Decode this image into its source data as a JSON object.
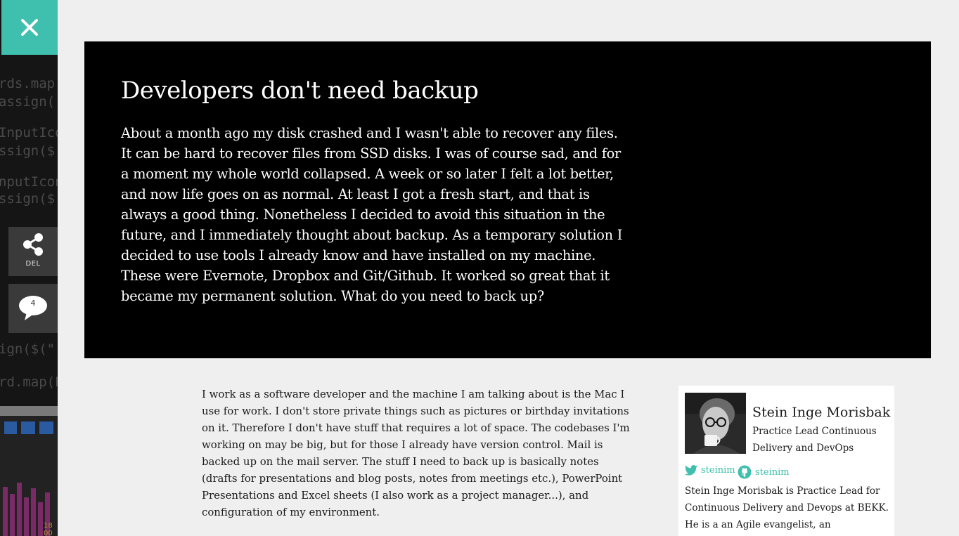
{
  "sidebar": {
    "close_icon": "close-icon",
    "share": {
      "icon": "share-icon",
      "label": "DEL"
    },
    "comments": {
      "icon": "comment-bubble-icon",
      "count": "4"
    },
    "code_lines": [
      "rds.map(",
      "assign(",
      "InputIco",
      "ssign($",
      "nputIcon",
      "ssign($(",
      "ign($(\"[",
      "rd.map(E"
    ],
    "screenshot_label": "18 00"
  },
  "article": {
    "title": "Developers don't need backup",
    "intro": "About a month ago my disk crashed and I wasn't able to recover any files. It can be hard to recover files from SSD disks. I was of course sad, and for a moment my whole world collapsed. A week or so later I felt a lot better, and now life goes on as normal. At least I got a fresh start, and that is always a good thing. Nonetheless I decided to avoid this situation in the future, and I immediately thought about backup. As a temporary solution I decided to use tools I already know and have installed on my machine. These were Evernote, Dropbox and Git/Github. It worked so great that it became my permanent solution. What do you need to back up?",
    "body": "I work as a software developer and the machine I am talking about is the Mac I use for work. I don't store private things such as pictures or birthday invitations on it. Therefore I don't have stuff that requires a lot of space. The codebases I'm working on may be big, but for those I already have version control. Mail is backed up on the mail server. The stuff I need to back up is basically notes (drafts for presentations and blog posts, notes from meetings etc.), PowerPoint Presentations and Excel sheets (I also work as a project manager...), and configuration of my environment."
  },
  "author": {
    "name": "Stein Inge Morisbak",
    "role": "Practice Lead Continuous Delivery and DevOps",
    "twitter": {
      "icon": "twitter-icon",
      "handle": "steinim"
    },
    "github": {
      "icon": "github-icon",
      "handle": "steinim"
    },
    "bio": "Stein Inge Morisbak is Practice Lead for Continuous Delivery and Devops at BEKK. He is a an Agile evangelist, an experienced speaker"
  },
  "colors": {
    "accent": "#3fbfad",
    "hero_background": "#000000",
    "page_background": "#efefef",
    "rail_background": "#1a1a1a"
  }
}
